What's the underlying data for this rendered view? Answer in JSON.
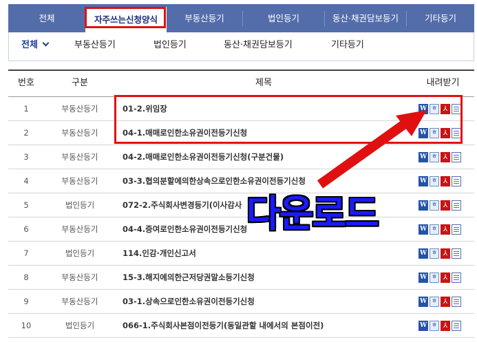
{
  "top_tabs": [
    {
      "label": "전체"
    },
    {
      "label": "자주쓰는신청양식"
    },
    {
      "label": "부동산등기"
    },
    {
      "label": "법인등기"
    },
    {
      "label": "동산·채권담보등기"
    },
    {
      "label": "기타등기"
    }
  ],
  "active_tab": "자주쓰는신청양식",
  "sub_nav": [
    {
      "label": "전체"
    },
    {
      "label": "부동산등기"
    },
    {
      "label": "법인등기"
    },
    {
      "label": "동산·채권담보등기"
    },
    {
      "label": "기타등기"
    }
  ],
  "table": {
    "headers": {
      "no": "번호",
      "category": "구분",
      "title": "제목",
      "download": "내려받기"
    },
    "rows": [
      {
        "no": "1",
        "category": "부동산등기",
        "title": "01-2.위임장"
      },
      {
        "no": "2",
        "category": "부동산등기",
        "title": "04-1.매매로인한소유권이전등기신청"
      },
      {
        "no": "3",
        "category": "부동산등기",
        "title": "04-2.매매로인한소유권이전등기신청(구분건물)"
      },
      {
        "no": "4",
        "category": "부동산등기",
        "title": "03-3.협의분할에의한상속으로인한소유권이전등기신청"
      },
      {
        "no": "5",
        "category": "법인등기",
        "title": "072-2.주식회사변경등기(이사감사"
      },
      {
        "no": "6",
        "category": "부동산등기",
        "title": "04-4.증여로인한소유권이전등기신청"
      },
      {
        "no": "7",
        "category": "법인등기",
        "title": "114.인감·개인신고서"
      },
      {
        "no": "8",
        "category": "부동산등기",
        "title": "15-3.해지에의한근저당권말소등기신청"
      },
      {
        "no": "9",
        "category": "부동산등기",
        "title": "03-1.상속으로인한소유권이전등기신청"
      },
      {
        "no": "10",
        "category": "법인등기",
        "title": "066-1.주식회사본점이전등기(동일관할 내에서의 본점이전)"
      }
    ],
    "download_icons": [
      "word-icon",
      "hwp-icon",
      "pdf-icon",
      "text-doc-icon"
    ]
  },
  "annotation": {
    "label": "다운로드",
    "color": "#1a1aff",
    "highlight_color": "#e01010"
  },
  "colors": {
    "nav_bg": "#536dab",
    "active_tab_text": "#1a2f7a"
  }
}
